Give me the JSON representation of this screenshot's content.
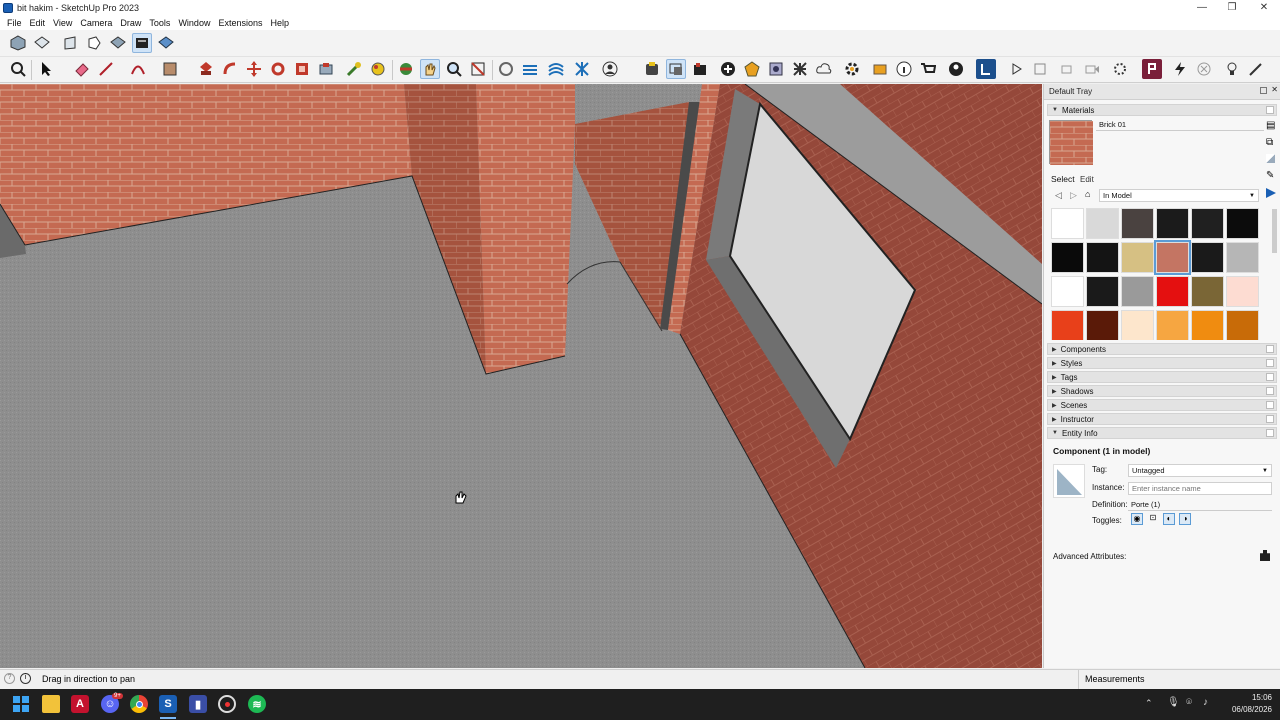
{
  "window": {
    "title": "bit hakim - SketchUp Pro 2023",
    "min": "—",
    "max": "❐",
    "close": "✕"
  },
  "menu": [
    "File",
    "Edit",
    "View",
    "Camera",
    "Draw",
    "Tools",
    "Window",
    "Extensions",
    "Help"
  ],
  "tray": {
    "title": "Default Tray",
    "materials": {
      "header": "Materials",
      "current_name": "Brick 01",
      "tab_select": "Select",
      "tab_edit": "Edit",
      "library": "In Model",
      "swatch_colors": [
        "#ffffff",
        "#d9d9d9",
        "#4a4240",
        "#1b1b1b",
        "#202020",
        "#0c0c0c",
        "#0a0a0a",
        "#141414",
        "#d6c083",
        "#c47563",
        "#1a1a1a",
        "#b6b6b6",
        "#ffffff",
        "#1a1a1a",
        "#9a9a9a",
        "#e41010",
        "#7a6636",
        "#fddcd2",
        "#e8401a",
        "#5a1a08",
        "#fde6cc",
        "#f6a641",
        "#f08c10",
        "#c86b08"
      ],
      "selected_swatch": 9
    },
    "sections": [
      "Components",
      "Styles",
      "Tags",
      "Shadows",
      "Scenes",
      "Instructor",
      "Entity Info"
    ],
    "entity_info": {
      "heading": "Component (1 in model)",
      "tag_label": "Tag:",
      "tag_value": "Untagged",
      "instance_label": "Instance:",
      "instance_placeholder": "Enter instance name",
      "definition_label": "Definition:",
      "definition_value": "Porte (1)",
      "toggles_label": "Toggles:",
      "advanced_label": "Advanced Attributes:"
    }
  },
  "status": {
    "hint": "Drag in direction to pan",
    "measurements_label": "Measurements"
  },
  "taskbar": {
    "time": "15:06",
    "date": "06/08/2026",
    "badge": "9+"
  },
  "colors": {
    "brick": "#c46a52",
    "floor": "#8e8e8e",
    "accent": "#1a5fb4"
  }
}
